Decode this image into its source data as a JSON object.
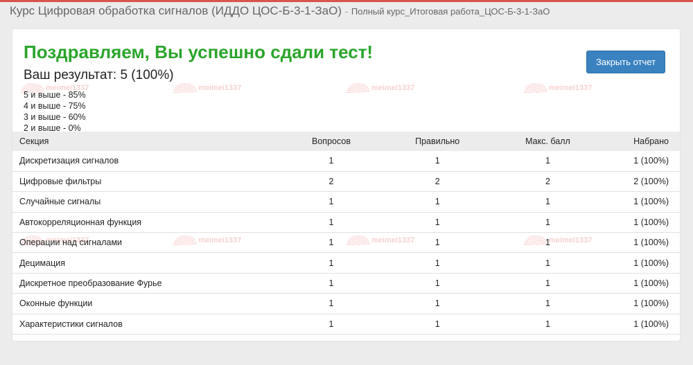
{
  "header": {
    "course_title": "Курс Цифровая обработка сигналов (ИДДО ЦОС-Б-3-1-ЗаО)",
    "separator": "-",
    "subtitle": "Полный курс_Итоговая работа_ЦОС-Б-3-1-ЗаО"
  },
  "report": {
    "congrats": "Поздравляем, Вы успешно сдали тест!",
    "result_text": "Ваш результат: 5 (100%)",
    "close_button": "Закрыть отчет",
    "scale": [
      "5 и выше - 85%",
      "4 и выше - 75%",
      "3 и выше - 60%",
      "2 и выше - 0%"
    ]
  },
  "table": {
    "headers": {
      "section": "Секция",
      "questions": "Вопросов",
      "correct": "Правильно",
      "max": "Макс. балл",
      "scored": "Набрано"
    },
    "rows": [
      {
        "section": "Дискретизация сигналов",
        "questions": "1",
        "correct": "1",
        "max": "1",
        "scored": "1 (100%)"
      },
      {
        "section": "Цифровые фильтры",
        "questions": "2",
        "correct": "2",
        "max": "2",
        "scored": "2 (100%)"
      },
      {
        "section": "Случайные сигналы",
        "questions": "1",
        "correct": "1",
        "max": "1",
        "scored": "1 (100%)"
      },
      {
        "section": "Автокорреляционная функция",
        "questions": "1",
        "correct": "1",
        "max": "1",
        "scored": "1 (100%)"
      },
      {
        "section": "Операции над сигналами",
        "questions": "1",
        "correct": "1",
        "max": "1",
        "scored": "1 (100%)"
      },
      {
        "section": "Децимация",
        "questions": "1",
        "correct": "1",
        "max": "1",
        "scored": "1 (100%)"
      },
      {
        "section": "Дискретное преобразование Фурье",
        "questions": "1",
        "correct": "1",
        "max": "1",
        "scored": "1 (100%)"
      },
      {
        "section": "Оконные функции",
        "questions": "1",
        "correct": "1",
        "max": "1",
        "scored": "1 (100%)"
      },
      {
        "section": "Характеристики сигналов",
        "questions": "1",
        "correct": "1",
        "max": "1",
        "scored": "1 (100%)"
      }
    ]
  },
  "watermark": {
    "text": "meimei1337",
    "color": "#dc2828"
  },
  "colors": {
    "success": "#2ba52b",
    "primary_button": "#3a82c0",
    "accent_top": "#d9534f"
  }
}
